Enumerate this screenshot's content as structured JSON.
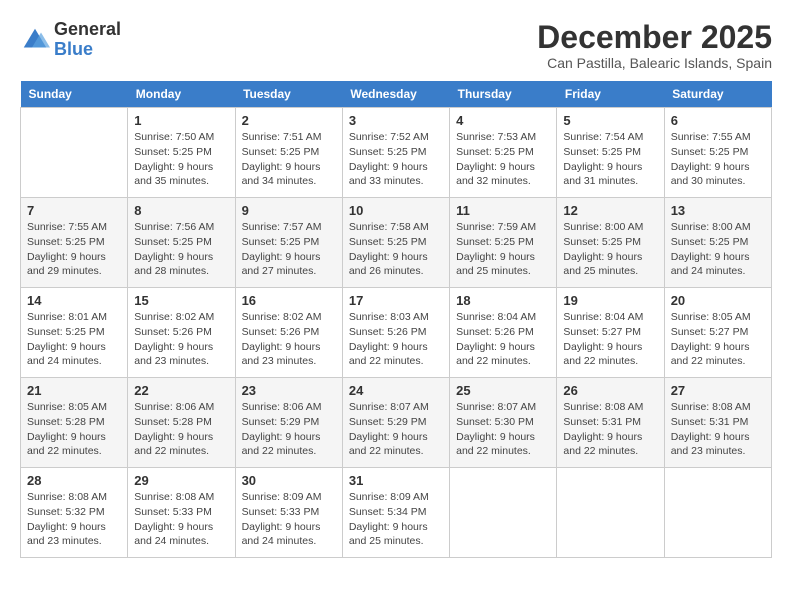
{
  "logo": {
    "general": "General",
    "blue": "Blue"
  },
  "title": "December 2025",
  "subtitle": "Can Pastilla, Balearic Islands, Spain",
  "days_of_week": [
    "Sunday",
    "Monday",
    "Tuesday",
    "Wednesday",
    "Thursday",
    "Friday",
    "Saturday"
  ],
  "weeks": [
    [
      {
        "day": "",
        "sunrise": "",
        "sunset": "",
        "daylight": ""
      },
      {
        "day": "1",
        "sunrise": "Sunrise: 7:50 AM",
        "sunset": "Sunset: 5:25 PM",
        "daylight": "Daylight: 9 hours and 35 minutes."
      },
      {
        "day": "2",
        "sunrise": "Sunrise: 7:51 AM",
        "sunset": "Sunset: 5:25 PM",
        "daylight": "Daylight: 9 hours and 34 minutes."
      },
      {
        "day": "3",
        "sunrise": "Sunrise: 7:52 AM",
        "sunset": "Sunset: 5:25 PM",
        "daylight": "Daylight: 9 hours and 33 minutes."
      },
      {
        "day": "4",
        "sunrise": "Sunrise: 7:53 AM",
        "sunset": "Sunset: 5:25 PM",
        "daylight": "Daylight: 9 hours and 32 minutes."
      },
      {
        "day": "5",
        "sunrise": "Sunrise: 7:54 AM",
        "sunset": "Sunset: 5:25 PM",
        "daylight": "Daylight: 9 hours and 31 minutes."
      },
      {
        "day": "6",
        "sunrise": "Sunrise: 7:55 AM",
        "sunset": "Sunset: 5:25 PM",
        "daylight": "Daylight: 9 hours and 30 minutes."
      }
    ],
    [
      {
        "day": "7",
        "sunrise": "Sunrise: 7:55 AM",
        "sunset": "Sunset: 5:25 PM",
        "daylight": "Daylight: 9 hours and 29 minutes."
      },
      {
        "day": "8",
        "sunrise": "Sunrise: 7:56 AM",
        "sunset": "Sunset: 5:25 PM",
        "daylight": "Daylight: 9 hours and 28 minutes."
      },
      {
        "day": "9",
        "sunrise": "Sunrise: 7:57 AM",
        "sunset": "Sunset: 5:25 PM",
        "daylight": "Daylight: 9 hours and 27 minutes."
      },
      {
        "day": "10",
        "sunrise": "Sunrise: 7:58 AM",
        "sunset": "Sunset: 5:25 PM",
        "daylight": "Daylight: 9 hours and 26 minutes."
      },
      {
        "day": "11",
        "sunrise": "Sunrise: 7:59 AM",
        "sunset": "Sunset: 5:25 PM",
        "daylight": "Daylight: 9 hours and 25 minutes."
      },
      {
        "day": "12",
        "sunrise": "Sunrise: 8:00 AM",
        "sunset": "Sunset: 5:25 PM",
        "daylight": "Daylight: 9 hours and 25 minutes."
      },
      {
        "day": "13",
        "sunrise": "Sunrise: 8:00 AM",
        "sunset": "Sunset: 5:25 PM",
        "daylight": "Daylight: 9 hours and 24 minutes."
      }
    ],
    [
      {
        "day": "14",
        "sunrise": "Sunrise: 8:01 AM",
        "sunset": "Sunset: 5:25 PM",
        "daylight": "Daylight: 9 hours and 24 minutes."
      },
      {
        "day": "15",
        "sunrise": "Sunrise: 8:02 AM",
        "sunset": "Sunset: 5:26 PM",
        "daylight": "Daylight: 9 hours and 23 minutes."
      },
      {
        "day": "16",
        "sunrise": "Sunrise: 8:02 AM",
        "sunset": "Sunset: 5:26 PM",
        "daylight": "Daylight: 9 hours and 23 minutes."
      },
      {
        "day": "17",
        "sunrise": "Sunrise: 8:03 AM",
        "sunset": "Sunset: 5:26 PM",
        "daylight": "Daylight: 9 hours and 22 minutes."
      },
      {
        "day": "18",
        "sunrise": "Sunrise: 8:04 AM",
        "sunset": "Sunset: 5:26 PM",
        "daylight": "Daylight: 9 hours and 22 minutes."
      },
      {
        "day": "19",
        "sunrise": "Sunrise: 8:04 AM",
        "sunset": "Sunset: 5:27 PM",
        "daylight": "Daylight: 9 hours and 22 minutes."
      },
      {
        "day": "20",
        "sunrise": "Sunrise: 8:05 AM",
        "sunset": "Sunset: 5:27 PM",
        "daylight": "Daylight: 9 hours and 22 minutes."
      }
    ],
    [
      {
        "day": "21",
        "sunrise": "Sunrise: 8:05 AM",
        "sunset": "Sunset: 5:28 PM",
        "daylight": "Daylight: 9 hours and 22 minutes."
      },
      {
        "day": "22",
        "sunrise": "Sunrise: 8:06 AM",
        "sunset": "Sunset: 5:28 PM",
        "daylight": "Daylight: 9 hours and 22 minutes."
      },
      {
        "day": "23",
        "sunrise": "Sunrise: 8:06 AM",
        "sunset": "Sunset: 5:29 PM",
        "daylight": "Daylight: 9 hours and 22 minutes."
      },
      {
        "day": "24",
        "sunrise": "Sunrise: 8:07 AM",
        "sunset": "Sunset: 5:29 PM",
        "daylight": "Daylight: 9 hours and 22 minutes."
      },
      {
        "day": "25",
        "sunrise": "Sunrise: 8:07 AM",
        "sunset": "Sunset: 5:30 PM",
        "daylight": "Daylight: 9 hours and 22 minutes."
      },
      {
        "day": "26",
        "sunrise": "Sunrise: 8:08 AM",
        "sunset": "Sunset: 5:31 PM",
        "daylight": "Daylight: 9 hours and 22 minutes."
      },
      {
        "day": "27",
        "sunrise": "Sunrise: 8:08 AM",
        "sunset": "Sunset: 5:31 PM",
        "daylight": "Daylight: 9 hours and 23 minutes."
      }
    ],
    [
      {
        "day": "28",
        "sunrise": "Sunrise: 8:08 AM",
        "sunset": "Sunset: 5:32 PM",
        "daylight": "Daylight: 9 hours and 23 minutes."
      },
      {
        "day": "29",
        "sunrise": "Sunrise: 8:08 AM",
        "sunset": "Sunset: 5:33 PM",
        "daylight": "Daylight: 9 hours and 24 minutes."
      },
      {
        "day": "30",
        "sunrise": "Sunrise: 8:09 AM",
        "sunset": "Sunset: 5:33 PM",
        "daylight": "Daylight: 9 hours and 24 minutes."
      },
      {
        "day": "31",
        "sunrise": "Sunrise: 8:09 AM",
        "sunset": "Sunset: 5:34 PM",
        "daylight": "Daylight: 9 hours and 25 minutes."
      },
      {
        "day": "",
        "sunrise": "",
        "sunset": "",
        "daylight": ""
      },
      {
        "day": "",
        "sunrise": "",
        "sunset": "",
        "daylight": ""
      },
      {
        "day": "",
        "sunrise": "",
        "sunset": "",
        "daylight": ""
      }
    ]
  ]
}
